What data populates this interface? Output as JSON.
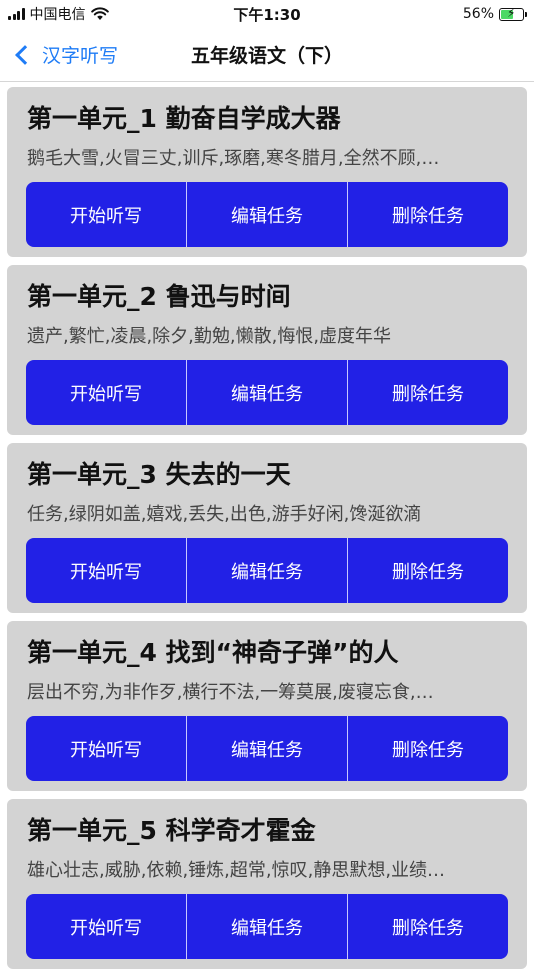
{
  "status_bar": {
    "carrier": "中国电信",
    "time": "下午1:30",
    "battery": "56%",
    "battery_level": 0.56,
    "icons": [
      "signal-icon",
      "wifi-icon",
      "battery-icon",
      "charging-bolt-icon"
    ]
  },
  "nav": {
    "back_label": "汉字听写",
    "title": "五年级语文（下）",
    "accent": "#1f7cf6"
  },
  "colors": {
    "card_bg": "#d3d3d3",
    "button_bg": "#2221e6"
  },
  "tasks": [
    {
      "title": "第一单元_1 勤奋自学成大器",
      "words": "鹅毛大雪,火冒三丈,训斥,琢磨,寒冬腊月,全然不顾,…",
      "buttons": [
        "开始听写",
        "编辑任务",
        "删除任务"
      ]
    },
    {
      "title": "第一单元_2 鲁迅与时间",
      "words": "遗产,繁忙,凌晨,除夕,勤勉,懒散,悔恨,虚度年华",
      "buttons": [
        "开始听写",
        "编辑任务",
        "删除任务"
      ]
    },
    {
      "title": "第一单元_3 失去的一天",
      "words": "任务,绿阴如盖,嬉戏,丢失,出色,游手好闲,馋涎欲滴",
      "buttons": [
        "开始听写",
        "编辑任务",
        "删除任务"
      ]
    },
    {
      "title": "第一单元_4 找到“神奇子弹”的人",
      "words": "层出不穷,为非作歹,横行不法,一筹莫展,废寝忘食,…",
      "buttons": [
        "开始听写",
        "编辑任务",
        "删除任务"
      ]
    },
    {
      "title": "第一单元_5 科学奇才霍金",
      "words": "雄心壮志,威胁,依赖,锤炼,超常,惊叹,静思默想,业绩…",
      "buttons": [
        "开始听写",
        "编辑任务",
        "删除任务"
      ]
    }
  ]
}
